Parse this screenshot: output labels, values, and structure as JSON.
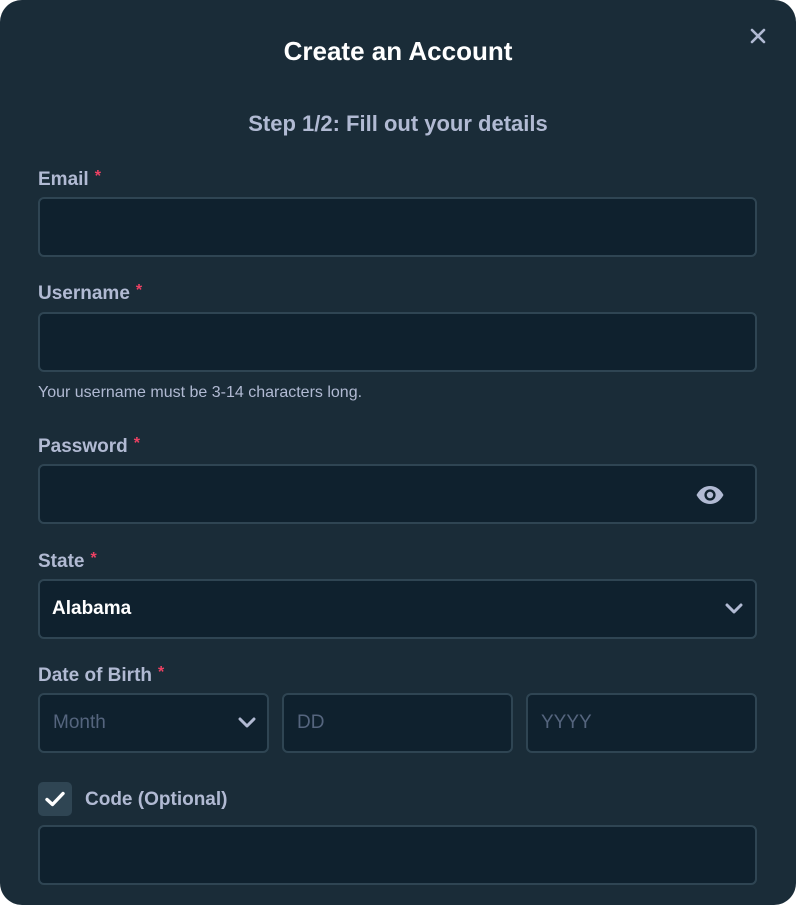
{
  "modal": {
    "title": "Create an Account",
    "subtitle": "Step 1/2: Fill out your details",
    "close_icon": "close-icon"
  },
  "form": {
    "required_mark": "*",
    "email": {
      "label": "Email",
      "value": ""
    },
    "username": {
      "label": "Username",
      "value": "",
      "hint": "Your username must be 3-14 characters long."
    },
    "password": {
      "label": "Password",
      "value": "",
      "toggle_icon": "eye-icon"
    },
    "state": {
      "label": "State",
      "selected": "Alabama",
      "icon": "chevron-down-icon"
    },
    "dob": {
      "label": "Date of Birth",
      "month_placeholder": "Month",
      "day_placeholder": "DD",
      "year_placeholder": "YYYY"
    },
    "code": {
      "label": "Code (Optional)",
      "checked": true,
      "value": ""
    }
  },
  "colors": {
    "background": "#1a2c38",
    "input_bg": "#0f212e",
    "border": "#2f4553",
    "label": "#b1bad3",
    "required": "#ed4163",
    "title": "#ffffff",
    "placeholder": "#55657e"
  }
}
